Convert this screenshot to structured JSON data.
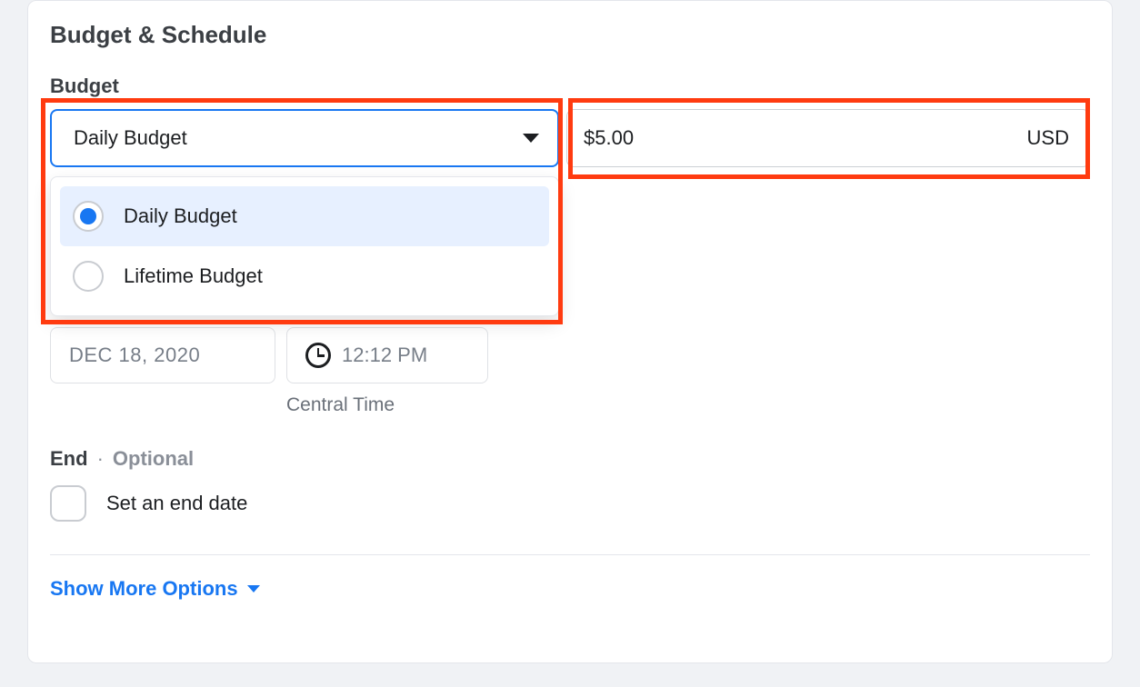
{
  "sectionTitle": "Budget & Schedule",
  "budget": {
    "label": "Budget",
    "selected": "Daily Budget",
    "options": [
      "Daily Budget",
      "Lifetime Budget"
    ],
    "amount": "$5.00",
    "currency": "USD"
  },
  "start": {
    "date": "Dec 18, 2020",
    "time": "12:12 PM",
    "timezone": "Central Time"
  },
  "end": {
    "label": "End",
    "separator": "·",
    "optional": "Optional",
    "checkboxLabel": "Set an end date"
  },
  "moreOptions": "Show More Options"
}
